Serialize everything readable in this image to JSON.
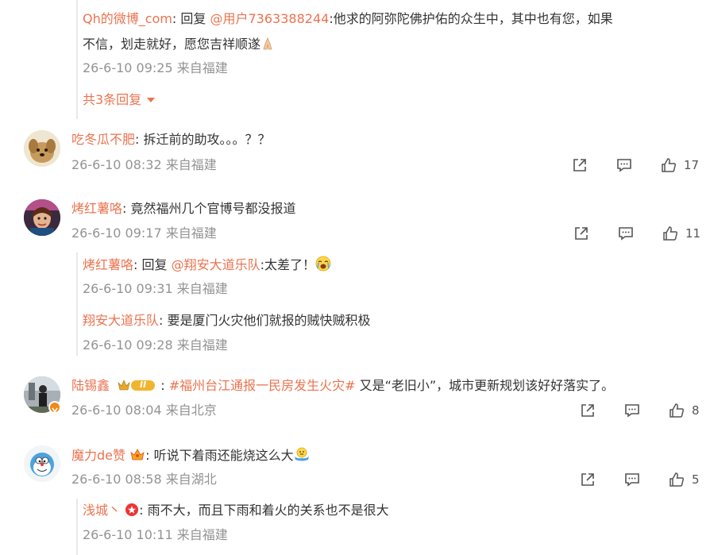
{
  "reply_top": {
    "name": "Qh的微博_com",
    "reply_word": ": 回复",
    "mention": "@用户7363388244",
    "text1": ":他求的阿弥陀佛护佑的众生中，其中也有您，如果",
    "text2": "不信，划走就好，愿您吉祥顺遂",
    "meta": "26-6-10 09:25 来自福建",
    "expand_label": "共3条回复"
  },
  "comments": [
    {
      "name": "吃冬瓜不肥",
      "text": ": 拆迁前的助攻。。。？？",
      "meta": "26-6-10 08:32 来自福建",
      "likes": "17"
    },
    {
      "name": "烤红薯咯",
      "text": ": 竟然福州几个官博号都没报道",
      "meta": "26-6-10 09:17 来自福建",
      "likes": "11"
    },
    {
      "name": "陆锡鑫",
      "hashtag": "#福州台江通报一民房发生火灾#",
      "text": " 又是“老旧小”，城市更新规划该好好落实了。",
      "meta": "26-6-10 08:04 来自北京",
      "likes": "8",
      "badge": "II"
    },
    {
      "name": "魔力de赞",
      "text": ": 听说下着雨还能烧这么大",
      "meta": "26-6-10 08:58 来自湖北",
      "likes": "5"
    }
  ],
  "replies_c2": [
    {
      "name": "烤红薯咯",
      "reply_word": ": 回复",
      "mention": "@翔安大道乐队",
      "text": ":太差了！",
      "meta": "26-6-10 09:31 来自福建"
    },
    {
      "name": "翔安大道乐队",
      "text": ": 要是厦门火灾他们就报的贼快贼积极",
      "meta": "26-6-10 09:28 来自福建"
    }
  ],
  "replies_c4": [
    {
      "name": "浅城丶",
      "text": ": 雨不大，而且下雨和着火的关系也不是很大",
      "meta": "26-6-10 10:11 来自福建"
    }
  ],
  "icons": {
    "share": "share-icon",
    "comment": "comment-icon",
    "like": "like-icon"
  },
  "colors": {
    "accent": "#eb7350",
    "meta": "#939393"
  }
}
